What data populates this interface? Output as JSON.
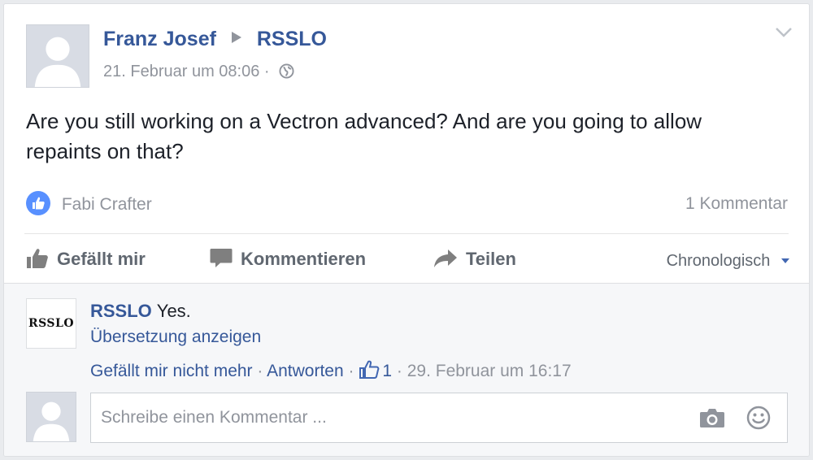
{
  "post": {
    "author": "Franz Josef",
    "target": "RSSLO",
    "timestamp": "21. Februar um 08:06",
    "separator": "·",
    "text": "Are you still working on a Vectron advanced? And are you going to allow repaints on that?",
    "liked_by": "Fabi Crafter",
    "comment_count": "1 Kommentar"
  },
  "actions": {
    "like": "Gefällt mir",
    "comment": "Kommentieren",
    "share": "Teilen",
    "sort": "Chronologisch"
  },
  "comment": {
    "avatar_text": "RSSLO",
    "author": "RSSLO",
    "text": "Yes.",
    "translate": "Übersetzung anzeigen",
    "unlike": "Gefällt mir nicht mehr",
    "sep1": "·",
    "reply": "Antworten",
    "sep2": "·",
    "likes": "1",
    "sep3": "·",
    "timestamp": "29. Februar um 16:17"
  },
  "composer": {
    "placeholder": "Schreibe einen Kommentar ..."
  },
  "icons": {
    "header_globe": "globe-icon",
    "chevron": "chevron-down-icon",
    "like": "thumbs-up-icon",
    "comment": "speech-bubble-icon",
    "share": "share-arrow-icon",
    "camera": "camera-icon",
    "emoji": "smiley-icon"
  },
  "colors": {
    "link": "#365899",
    "meta": "#90949c",
    "like_badge": "#5890ff",
    "background": "#e9ebee"
  }
}
